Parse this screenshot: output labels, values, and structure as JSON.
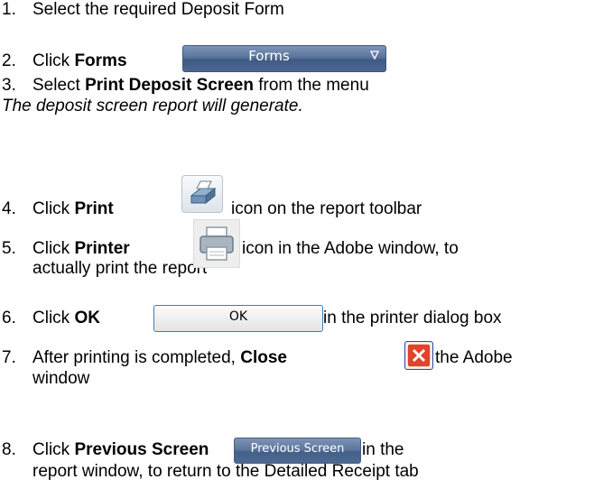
{
  "steps": [
    {
      "num": "1.",
      "text": "Select the required Deposit Form"
    },
    {
      "num": "2.",
      "pre": "Click ",
      "bold": "Forms"
    },
    {
      "num": "3.",
      "pre": "Select ",
      "bold": "Print Deposit Screen",
      "post": " from the menu"
    },
    {
      "note": "The deposit screen report will generate."
    },
    {
      "num": "4.",
      "pre": "Click ",
      "bold": "Print",
      "post": " icon on the report toolbar"
    },
    {
      "num": "5.",
      "pre": "Click ",
      "bold": "Printer",
      "post": " icon in the Adobe window, to",
      "line2": "actually print the report"
    },
    {
      "num": "6.",
      "pre": "Click ",
      "bold": "OK",
      "post": " in the printer dialog box"
    },
    {
      "num": "7.",
      "pre": "After printing is completed, ",
      "bold": "Close",
      "post": " the Adobe",
      "line2": "window"
    },
    {
      "num": "8.",
      "pre": "Click ",
      "bold": "Previous Screen",
      "post": " in the",
      "line2": "report window, to return to the Detailed Receipt tab"
    }
  ],
  "buttons": {
    "forms_label": "Forms",
    "ok_label": "OK",
    "previous_screen_label": "Previous Screen"
  },
  "icons": {
    "forms_caret": "chevron-down-icon",
    "print": "print-icon",
    "printer": "printer-icon",
    "close": "close-icon"
  },
  "colors": {
    "blue_button": "#5a749c",
    "close_red": "#e0442a"
  }
}
